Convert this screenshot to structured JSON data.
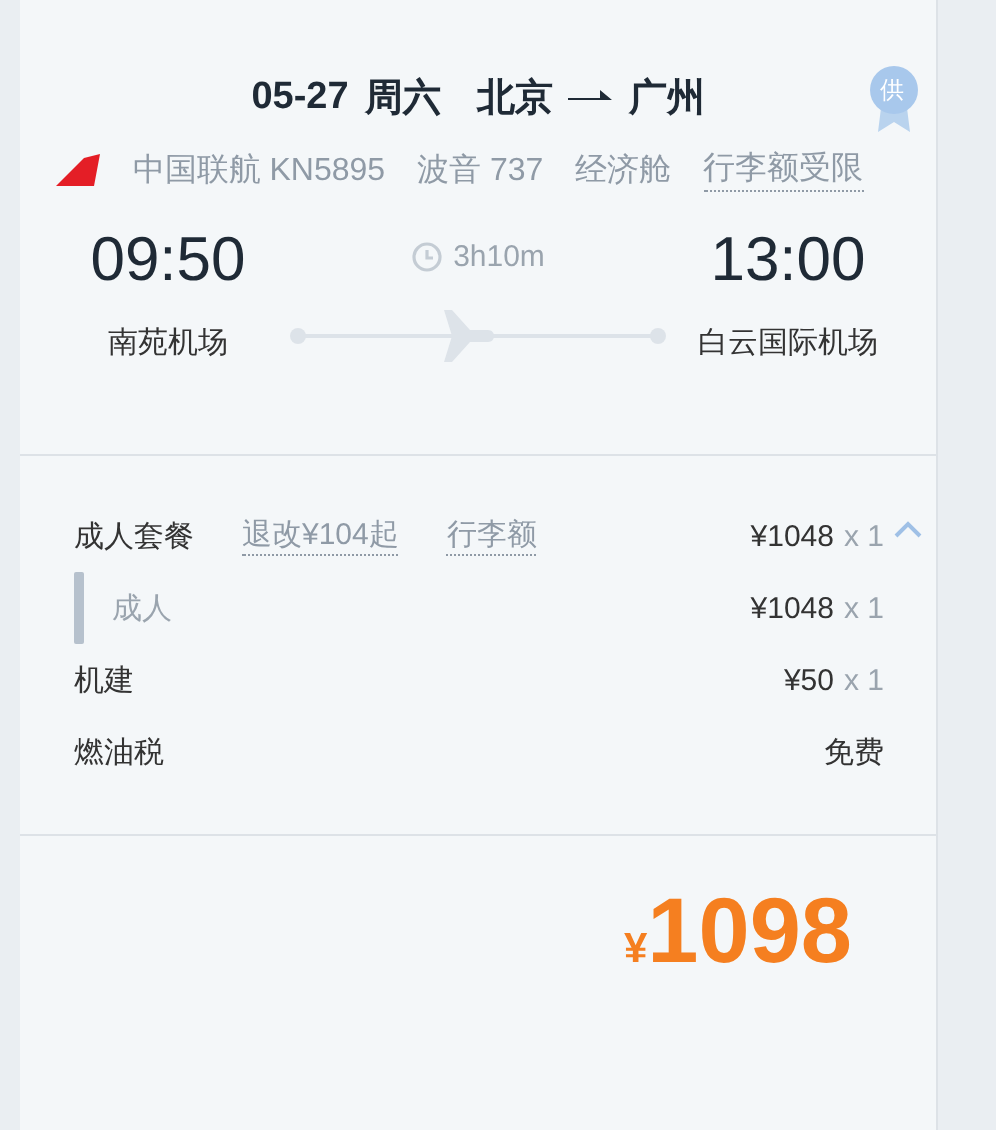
{
  "header": {
    "date": "05-27",
    "weekday": "周六",
    "from_city": "北京",
    "to_city": "广州",
    "badge": "供"
  },
  "flight_info": {
    "airline": "中国联航 KN5895",
    "aircraft": "波音 737",
    "cabin": "经济舱",
    "baggage_link": "行李额受限"
  },
  "departure": {
    "time": "09:50",
    "airport": "南苑机场"
  },
  "duration": "3h10m",
  "arrival": {
    "time": "13:00",
    "airport": "白云国际机场"
  },
  "package": {
    "name": "成人套餐",
    "refund_link": "退改¥104起",
    "baggage_link": "行李额",
    "price": "¥1048",
    "qty": "x 1",
    "expanded": true,
    "children": [
      {
        "name": "成人",
        "price": "¥1048",
        "qty": "x 1"
      }
    ]
  },
  "fees": [
    {
      "name": "机建",
      "price": "¥50",
      "qty": "x 1"
    },
    {
      "name": "燃油税",
      "price": "免费"
    }
  ],
  "total": {
    "currency": "¥",
    "amount": "1098"
  }
}
